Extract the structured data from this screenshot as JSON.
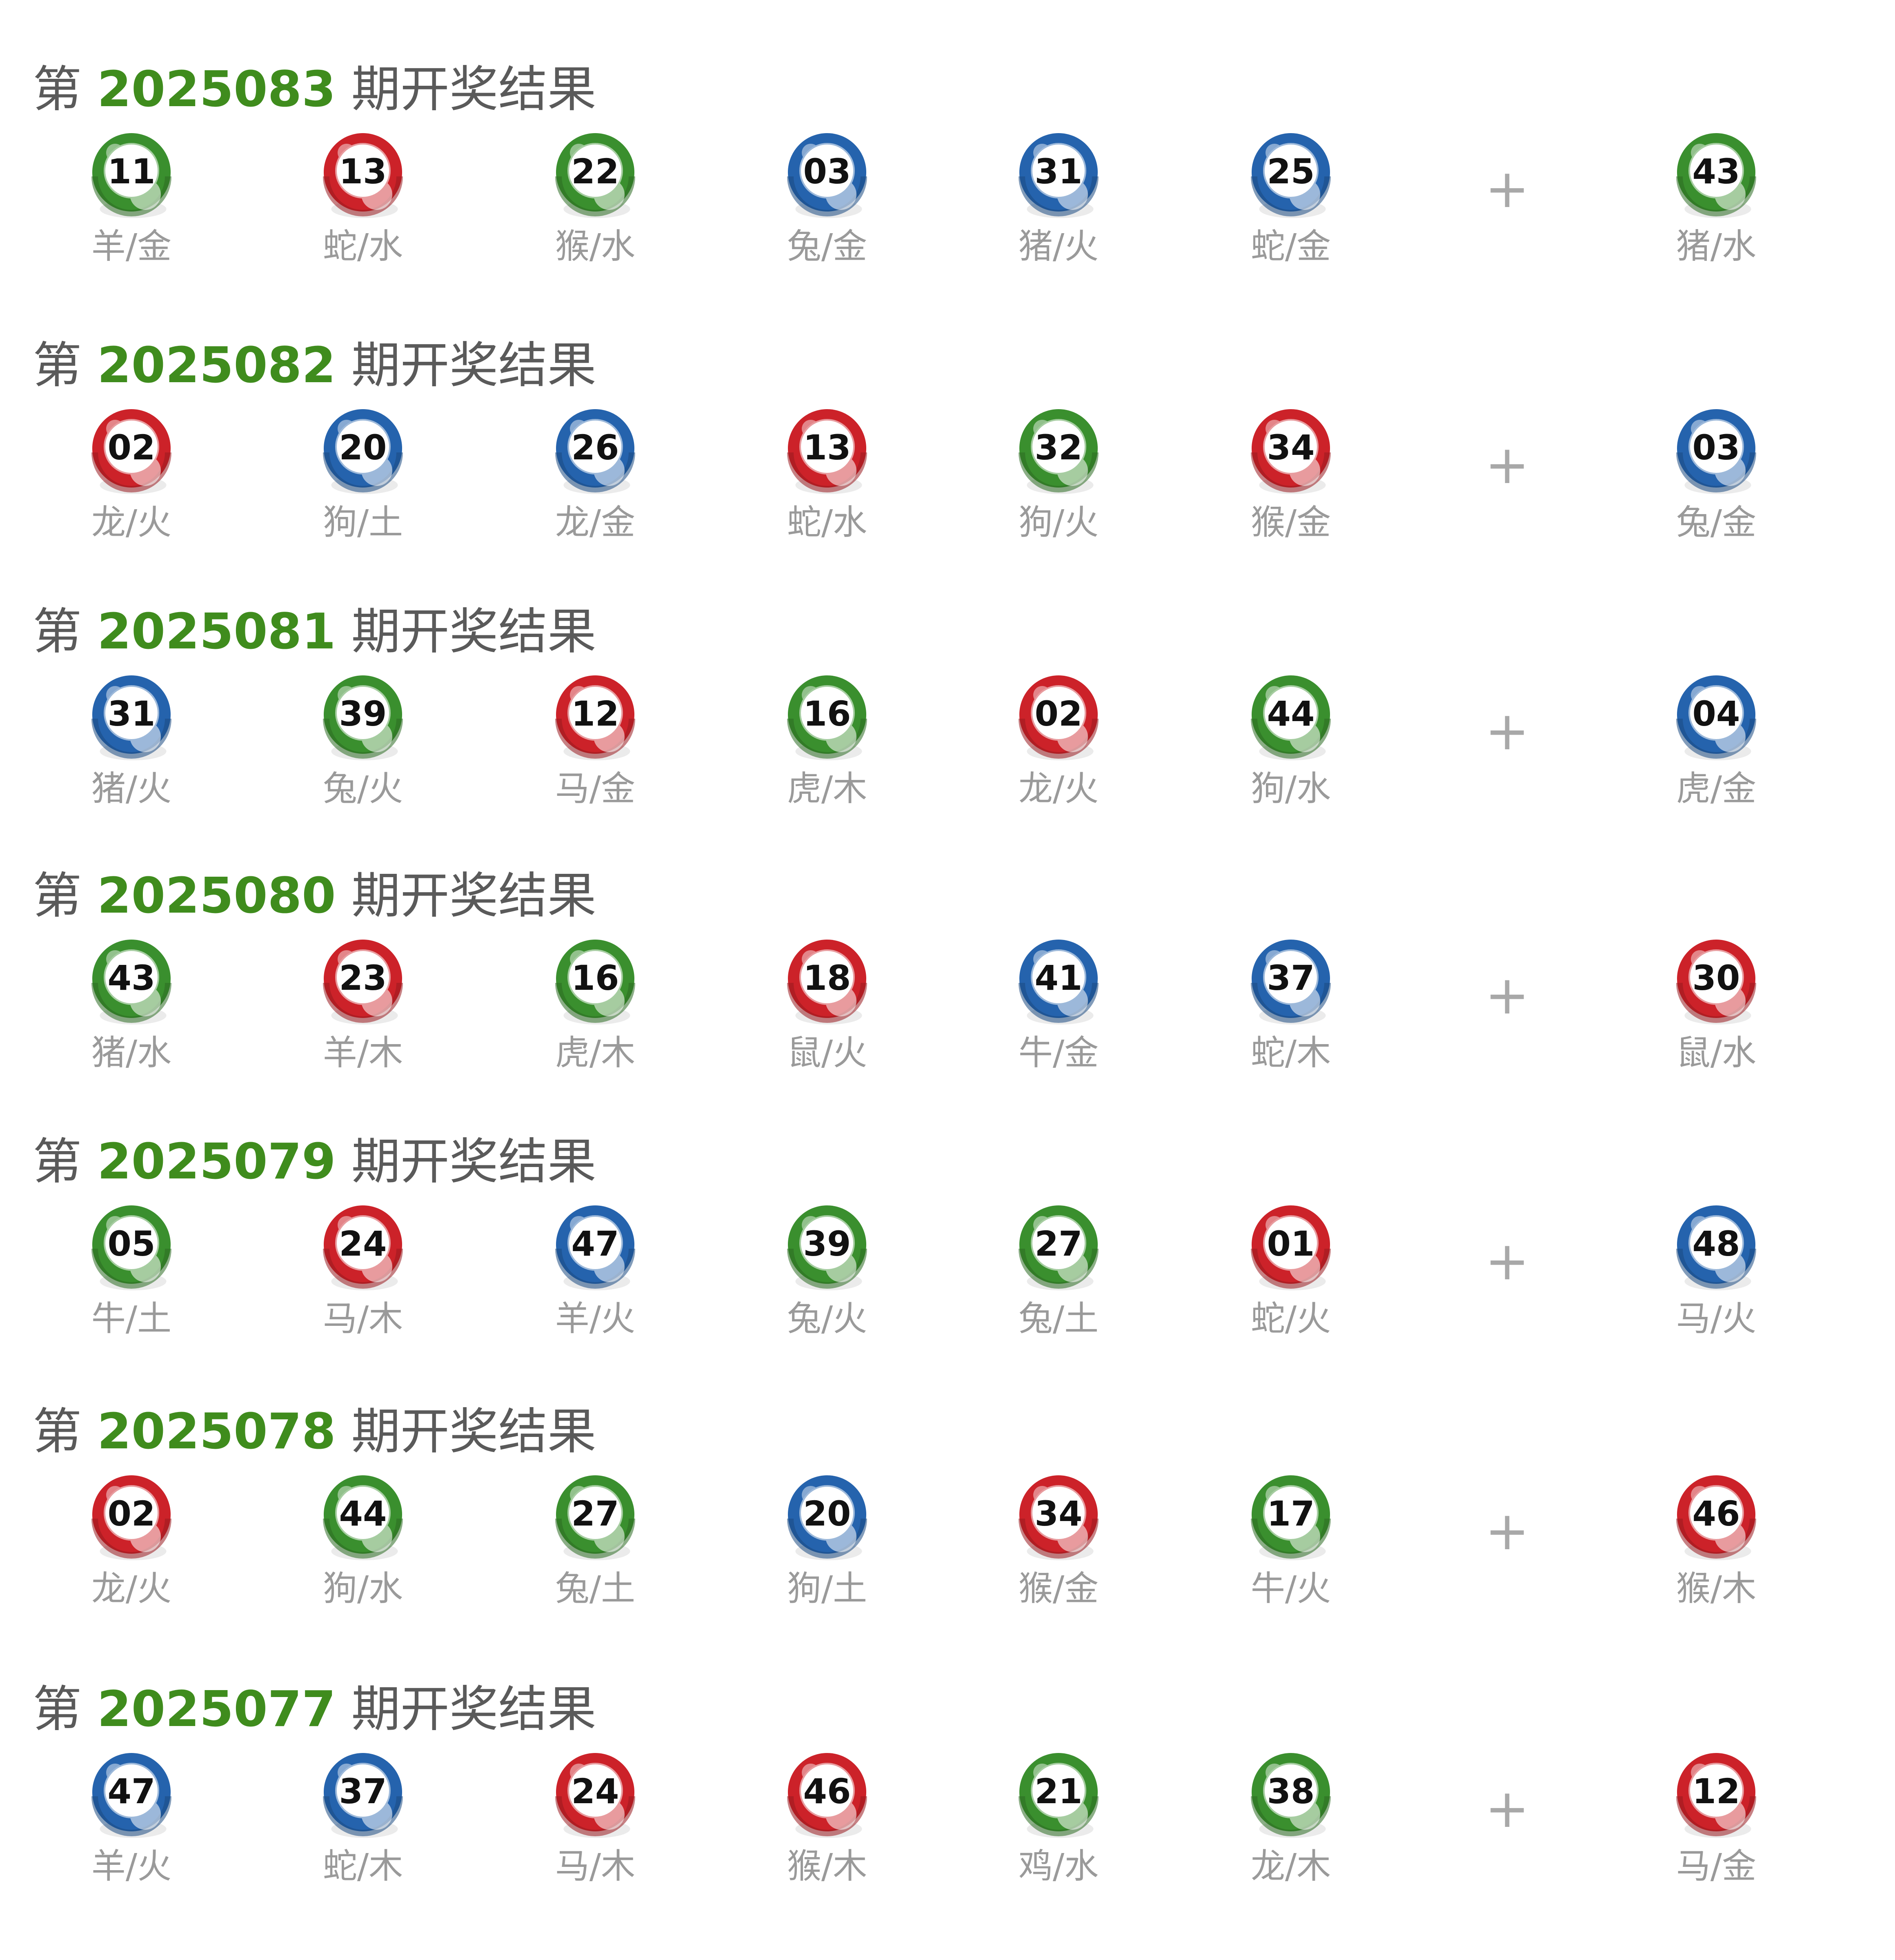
{
  "colors": {
    "red": "#cc2229",
    "green": "#3a8f2e",
    "blue": "#2563ad",
    "issue_text": "#3f8c1d",
    "title_text": "#5a5a5a",
    "label_text": "#9a9a9a"
  },
  "labels": {
    "title_prefix": "第",
    "title_suffix": "期开奖结果",
    "plus": "+"
  },
  "draws": [
    {
      "issue": "2025083",
      "balls": [
        {
          "num": "11",
          "color": "green",
          "label": "羊/金"
        },
        {
          "num": "13",
          "color": "red",
          "label": "蛇/水"
        },
        {
          "num": "22",
          "color": "green",
          "label": "猴/水"
        },
        {
          "num": "03",
          "color": "blue",
          "label": "兔/金"
        },
        {
          "num": "31",
          "color": "blue",
          "label": "猪/火"
        },
        {
          "num": "25",
          "color": "blue",
          "label": "蛇/金"
        }
      ],
      "special": {
        "num": "43",
        "color": "green",
        "label": "猪/水"
      }
    },
    {
      "issue": "2025082",
      "balls": [
        {
          "num": "02",
          "color": "red",
          "label": "龙/火"
        },
        {
          "num": "20",
          "color": "blue",
          "label": "狗/土"
        },
        {
          "num": "26",
          "color": "blue",
          "label": "龙/金"
        },
        {
          "num": "13",
          "color": "red",
          "label": "蛇/水"
        },
        {
          "num": "32",
          "color": "green",
          "label": "狗/火"
        },
        {
          "num": "34",
          "color": "red",
          "label": "猴/金"
        }
      ],
      "special": {
        "num": "03",
        "color": "blue",
        "label": "兔/金"
      }
    },
    {
      "issue": "2025081",
      "balls": [
        {
          "num": "31",
          "color": "blue",
          "label": "猪/火"
        },
        {
          "num": "39",
          "color": "green",
          "label": "兔/火"
        },
        {
          "num": "12",
          "color": "red",
          "label": "马/金"
        },
        {
          "num": "16",
          "color": "green",
          "label": "虎/木"
        },
        {
          "num": "02",
          "color": "red",
          "label": "龙/火"
        },
        {
          "num": "44",
          "color": "green",
          "label": "狗/水"
        }
      ],
      "special": {
        "num": "04",
        "color": "blue",
        "label": "虎/金"
      }
    },
    {
      "issue": "2025080",
      "balls": [
        {
          "num": "43",
          "color": "green",
          "label": "猪/水"
        },
        {
          "num": "23",
          "color": "red",
          "label": "羊/木"
        },
        {
          "num": "16",
          "color": "green",
          "label": "虎/木"
        },
        {
          "num": "18",
          "color": "red",
          "label": "鼠/火"
        },
        {
          "num": "41",
          "color": "blue",
          "label": "牛/金"
        },
        {
          "num": "37",
          "color": "blue",
          "label": "蛇/木"
        }
      ],
      "special": {
        "num": "30",
        "color": "red",
        "label": "鼠/水"
      }
    },
    {
      "issue": "2025079",
      "balls": [
        {
          "num": "05",
          "color": "green",
          "label": "牛/土"
        },
        {
          "num": "24",
          "color": "red",
          "label": "马/木"
        },
        {
          "num": "47",
          "color": "blue",
          "label": "羊/火"
        },
        {
          "num": "39",
          "color": "green",
          "label": "兔/火"
        },
        {
          "num": "27",
          "color": "green",
          "label": "兔/土"
        },
        {
          "num": "01",
          "color": "red",
          "label": "蛇/火"
        }
      ],
      "special": {
        "num": "48",
        "color": "blue",
        "label": "马/火"
      }
    },
    {
      "issue": "2025078",
      "balls": [
        {
          "num": "02",
          "color": "red",
          "label": "龙/火"
        },
        {
          "num": "44",
          "color": "green",
          "label": "狗/水"
        },
        {
          "num": "27",
          "color": "green",
          "label": "兔/土"
        },
        {
          "num": "20",
          "color": "blue",
          "label": "狗/土"
        },
        {
          "num": "34",
          "color": "red",
          "label": "猴/金"
        },
        {
          "num": "17",
          "color": "green",
          "label": "牛/火"
        }
      ],
      "special": {
        "num": "46",
        "color": "red",
        "label": "猴/木"
      }
    },
    {
      "issue": "2025077",
      "balls": [
        {
          "num": "47",
          "color": "blue",
          "label": "羊/火"
        },
        {
          "num": "37",
          "color": "blue",
          "label": "蛇/木"
        },
        {
          "num": "24",
          "color": "red",
          "label": "马/木"
        },
        {
          "num": "46",
          "color": "red",
          "label": "猴/木"
        },
        {
          "num": "21",
          "color": "green",
          "label": "鸡/水"
        },
        {
          "num": "38",
          "color": "green",
          "label": "龙/木"
        }
      ],
      "special": {
        "num": "12",
        "color": "red",
        "label": "马/金"
      }
    }
  ]
}
